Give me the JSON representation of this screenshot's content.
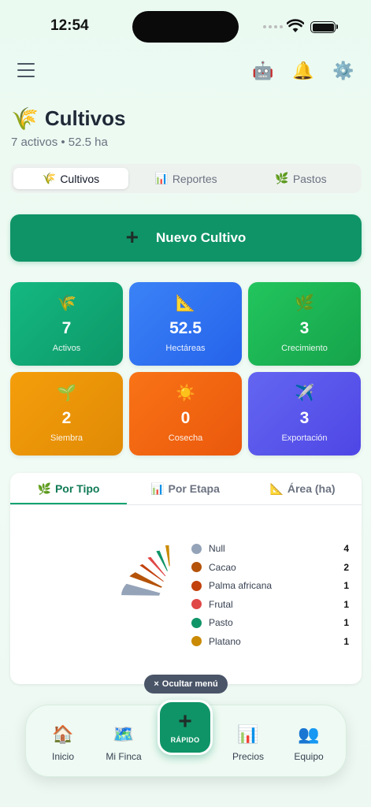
{
  "status": {
    "time": "12:54"
  },
  "header": {
    "emoji": "🌾",
    "title": "Cultivos",
    "subtitle": "7 activos • 52.5 ha"
  },
  "nav_icons": {
    "assistant": "🤖",
    "notifications": "🔔",
    "settings": "⚙️"
  },
  "segment_tabs": [
    {
      "icon": "🌾",
      "label": "Cultivos",
      "active": true
    },
    {
      "icon": "📊",
      "label": "Reportes",
      "active": false
    },
    {
      "icon": "🌿",
      "label": "Pastos",
      "active": false
    }
  ],
  "new_button": {
    "icon": "+",
    "label": "Nuevo Cultivo"
  },
  "stats": [
    {
      "icon": "🌾",
      "value": "7",
      "label": "Activos",
      "color": "#10b981"
    },
    {
      "icon": "📐",
      "value": "52.5",
      "label": "Hectáreas",
      "color": "#2f6ef0"
    },
    {
      "icon": "🌿",
      "value": "3",
      "label": "Crecimiento",
      "color": "#22b457"
    },
    {
      "icon": "🌱",
      "value": "2",
      "label": "Siembra",
      "color": "#f0a015"
    },
    {
      "icon": "☀️",
      "value": "0",
      "label": "Cosecha",
      "color": "#f2661e"
    },
    {
      "icon": "✈️",
      "value": "3",
      "label": "Exportación",
      "color": "#5b55ec"
    }
  ],
  "panel_tabs": [
    {
      "icon": "🌿",
      "label": "Por Tipo",
      "active": true
    },
    {
      "icon": "📊",
      "label": "Por Etapa",
      "active": false
    },
    {
      "icon": "📐",
      "label": "Área (ha)",
      "active": false
    }
  ],
  "chart_data": {
    "type": "pie",
    "categories": [
      "Null",
      "Cacao",
      "Palma africana",
      "Frutal",
      "Pasto",
      "Platano"
    ],
    "values": [
      4,
      2,
      1,
      1,
      1,
      1
    ],
    "colors": [
      "#94a3b8",
      "#b45309",
      "#c2410c",
      "#e04747",
      "#0f9467",
      "#ca8a04"
    ],
    "legend": "right"
  },
  "hide_menu": {
    "icon": "×",
    "label": "Ocultar menú"
  },
  "bottom_nav": [
    {
      "icon": "🏠",
      "label": "Inicio"
    },
    {
      "icon": "🗺️",
      "label": "Mi Finca"
    },
    {
      "icon": "📊",
      "label": "Precios"
    },
    {
      "icon": "👥",
      "label": "Equipo"
    }
  ],
  "fab": {
    "icon": "+",
    "label": "RÁPIDO"
  }
}
